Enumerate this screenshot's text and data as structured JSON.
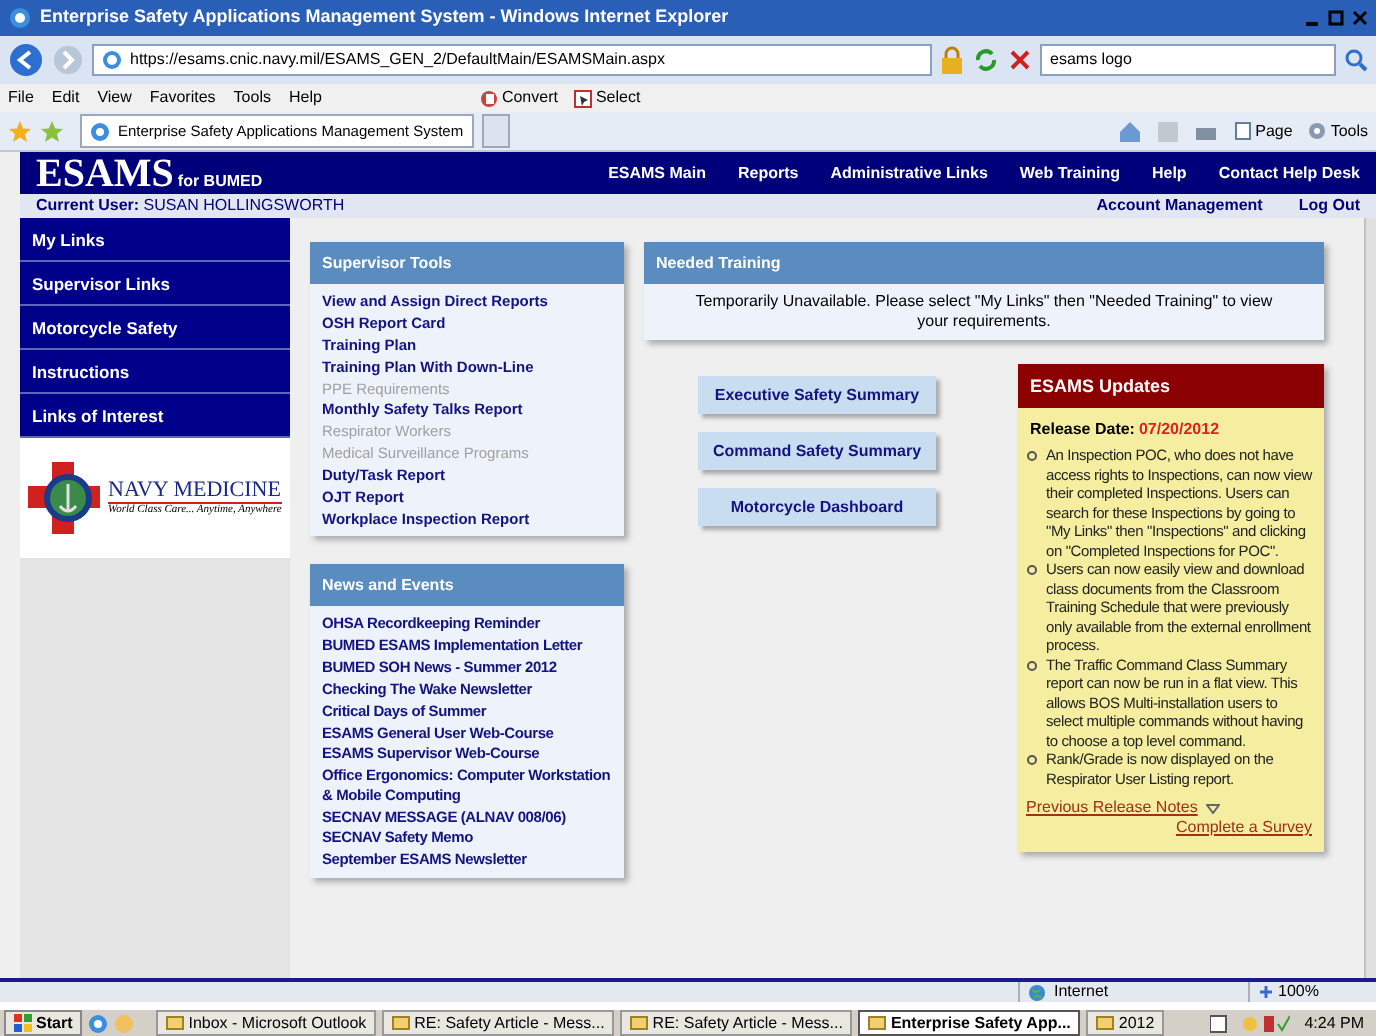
{
  "window": {
    "title": "Enterprise Safety Applications Management System - Windows Internet Explorer"
  },
  "browser": {
    "address": "https://esams.cnic.navy.mil/ESAMS_GEN_2/DefaultMain/ESAMSMain.aspx",
    "search": "esams logo",
    "menu": [
      "File",
      "Edit",
      "View",
      "Favorites",
      "Tools",
      "Help"
    ],
    "toolbar": [
      "Convert",
      "Select"
    ],
    "tab": "Enterprise Safety Applications Management System",
    "commands": [
      "Page",
      "Tools"
    ]
  },
  "header": {
    "logo": "ESAMS",
    "subtitle": "for BUMED",
    "nav": [
      "ESAMS Main",
      "Reports",
      "Administrative Links",
      "Web Training",
      "Help",
      "Contact Help Desk"
    ],
    "user_label": "Current User:",
    "user": "SUSAN HOLLINGSWORTH",
    "account_links": [
      "Account Management",
      "Log Out"
    ]
  },
  "sidebar": {
    "items": [
      "My Links",
      "Supervisor Links",
      "Motorcycle Safety",
      "Instructions",
      "Links of Interest"
    ],
    "logo": {
      "name": "NAVY MEDICINE",
      "tagline": "World Class Care... Anytime, Anywhere"
    }
  },
  "supervisor_tools": {
    "title": "Supervisor Tools",
    "items": [
      {
        "label": "View and Assign Direct Reports",
        "disabled": false
      },
      {
        "label": "OSH Report Card",
        "disabled": false
      },
      {
        "label": "Training Plan",
        "disabled": false
      },
      {
        "label": "Training Plan With Down-Line",
        "disabled": false
      },
      {
        "label": "PPE Requirements",
        "disabled": true
      },
      {
        "label": "Monthly Safety Talks Report",
        "disabled": false
      },
      {
        "label": "Respirator Workers",
        "disabled": true
      },
      {
        "label": "Medical Surveillance Programs",
        "disabled": true
      },
      {
        "label": "Duty/Task Report",
        "disabled": false
      },
      {
        "label": "OJT Report",
        "disabled": false
      },
      {
        "label": "Workplace Inspection Report",
        "disabled": false
      }
    ]
  },
  "news": {
    "title": "News and Events",
    "items": [
      "OHSA Recordkeeping Reminder",
      "BUMED ESAMS Implementation Letter",
      "BUMED SOH News - Summer 2012",
      "Checking The Wake Newsletter",
      "Critical Days of Summer",
      "ESAMS General User Web-Course",
      "ESAMS Supervisor Web-Course",
      "Office Ergonomics: Computer Workstation & Mobile Computing",
      "SECNAV MESSAGE (ALNAV 008/06)",
      "SECNAV Safety Memo",
      "September ESAMS Newsletter"
    ]
  },
  "needed_training": {
    "title": "Needed Training",
    "message": "Temporarily Unavailable. Please select \"My Links\" then \"Needed Training\" to view your requirements."
  },
  "summary_buttons": [
    "Executive Safety Summary",
    "Command Safety Summary",
    "Motorcycle Dashboard"
  ],
  "updates": {
    "title": "ESAMS Updates",
    "release_label": "Release Date:",
    "release_date": "07/20/2012",
    "bullets": [
      "An Inspection POC, who does not have access rights to Inspections, can now view their completed Inspections. Users can search for these Inspections by going to \"My Links\" then \"Inspections\" and clicking on \"Completed Inspections for POC\".",
      "Users can now easily view and download class documents from the Classroom Training Schedule that were previously only available from the external enrollment process.",
      "The Traffic Command Class Summary report can now be run in a flat view. This allows BOS Multi-installation users to select multiple commands without having to choose a top level command.",
      "Rank/Grade is now displayed on the Respirator User Listing report."
    ],
    "previous_link": "Previous Release Notes",
    "survey_link": "Complete a Survey"
  },
  "status_bar": {
    "zone": "Internet",
    "zoom": "100%"
  },
  "taskbar": {
    "start": "Start",
    "tasks": [
      {
        "label": "Inbox - Microsoft Outlook",
        "selected": false
      },
      {
        "label": "RE: Safety Article - Mess...",
        "selected": false
      },
      {
        "label": "RE: Safety Article - Mess...",
        "selected": false
      },
      {
        "label": "Enterprise Safety App...",
        "selected": true
      },
      {
        "label": "2012",
        "selected": false
      }
    ],
    "clock": "4:24 PM"
  }
}
